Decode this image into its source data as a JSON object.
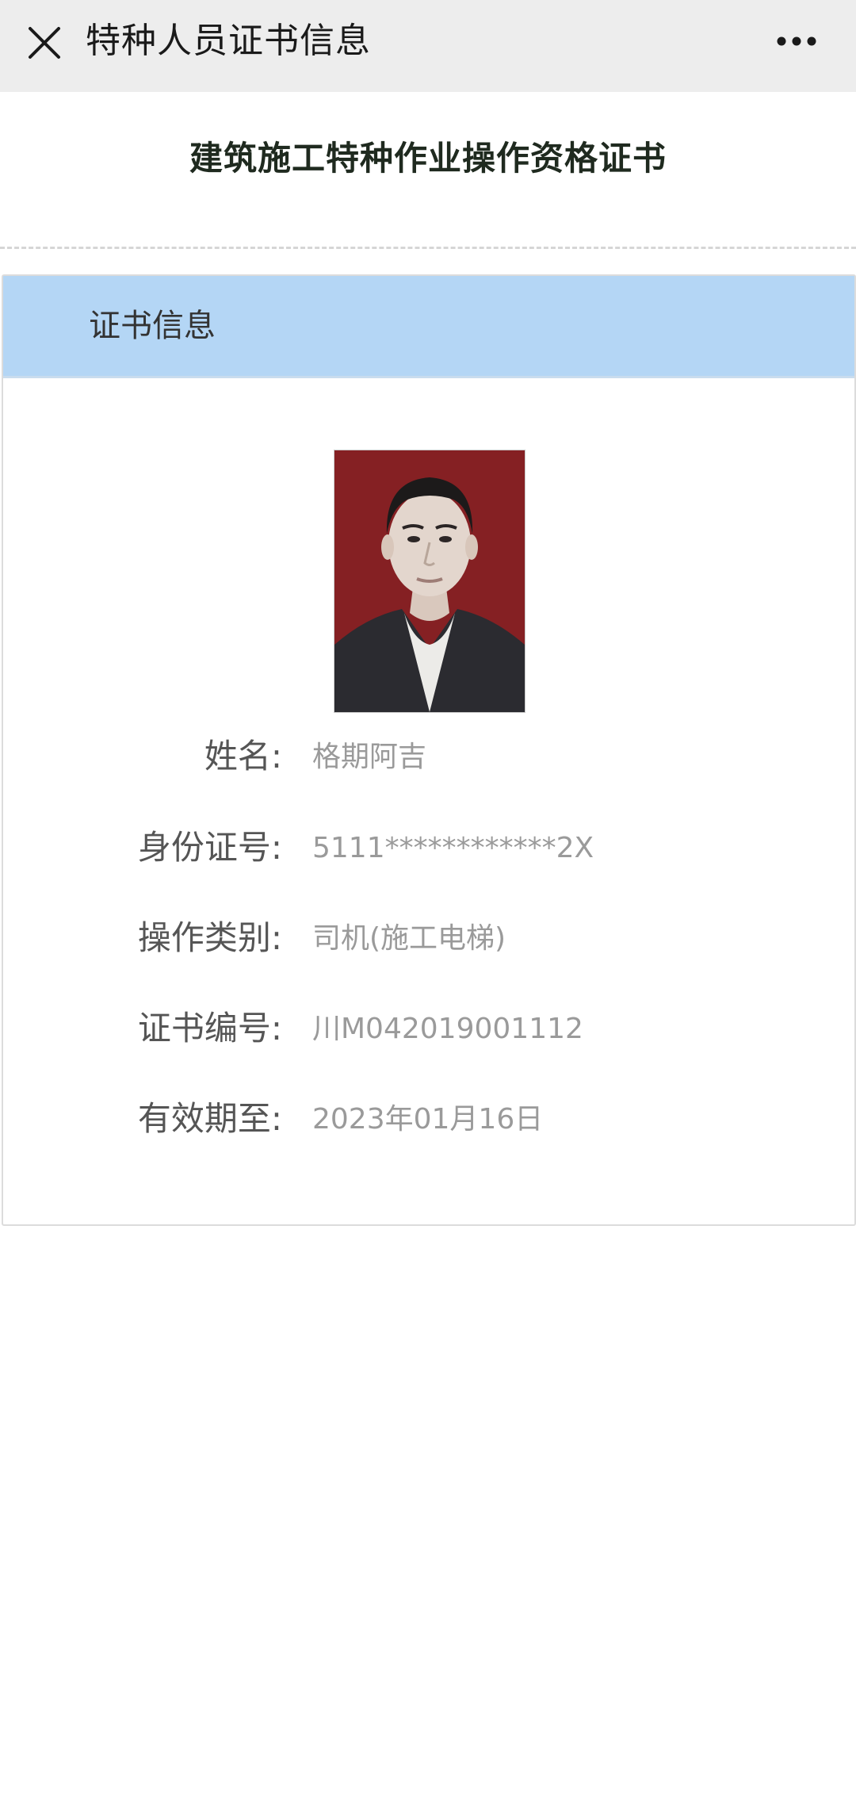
{
  "topbar": {
    "title": "特种人员证书信息",
    "close_icon": "close-icon",
    "more_icon": "more-horizontal-icon"
  },
  "heading": "建筑施工特种作业操作资格证书",
  "card": {
    "header_title": "证书信息",
    "fields": [
      {
        "label": "姓名:",
        "value": "格期阿吉"
      },
      {
        "label": "身份证号:",
        "value": "5111************2X"
      },
      {
        "label": "操作类别:",
        "value": "司机(施工电梯)"
      },
      {
        "label": "证书编号:",
        "value": "川M042019001112"
      },
      {
        "label": "有效期至:",
        "value": "2023年01月16日"
      }
    ]
  },
  "colors": {
    "topbar_bg": "#ededed",
    "card_header_bg": "#b4d6f5",
    "photo_bg": "#8a1f22"
  }
}
